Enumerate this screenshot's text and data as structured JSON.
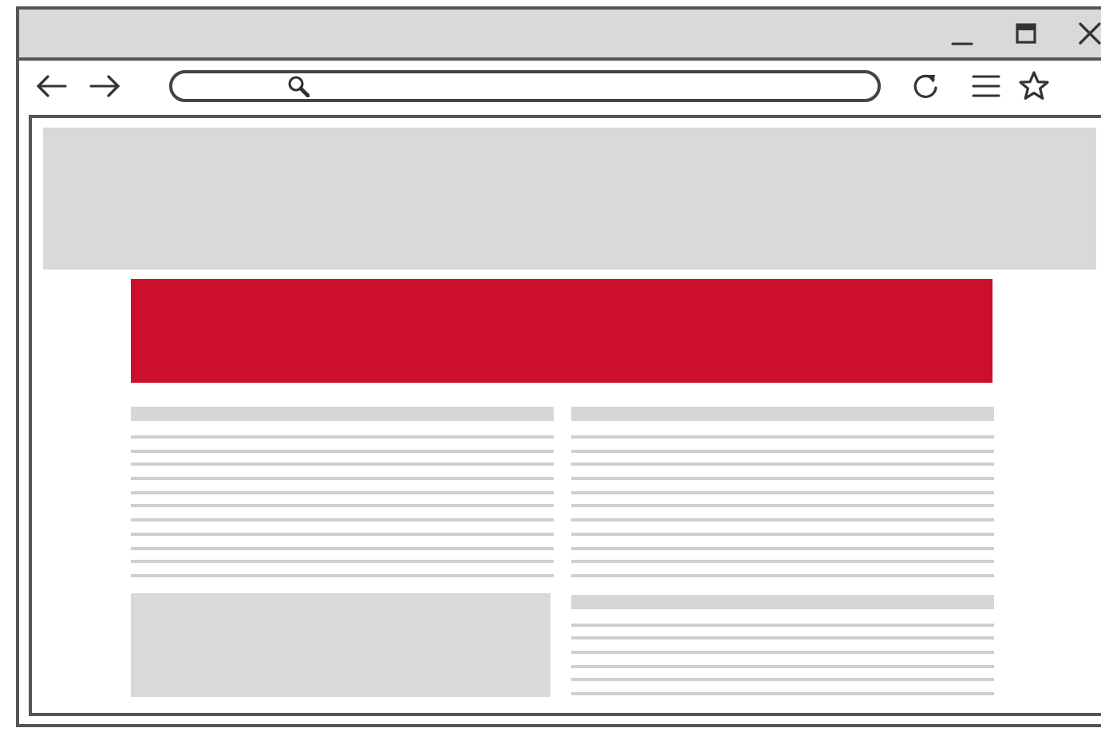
{
  "window": {
    "controls": [
      {
        "kind": "minimize"
      },
      {
        "kind": "maximize"
      },
      {
        "kind": "close"
      }
    ]
  },
  "toolbar": {
    "items": [
      {
        "kind": "back"
      },
      {
        "kind": "forward"
      },
      {
        "kind": "address"
      },
      {
        "kind": "reload"
      },
      {
        "kind": "menu"
      },
      {
        "kind": "bookmark"
      }
    ]
  },
  "page": {
    "header": {
      "kind": "placeholder"
    },
    "banner": {
      "color": "#cc0f2b"
    },
    "columns": [
      {
        "blocks": [
          {
            "kind": "heading"
          },
          {
            "kind": "line"
          },
          {
            "kind": "line"
          },
          {
            "kind": "line"
          },
          {
            "kind": "line"
          },
          {
            "kind": "line"
          },
          {
            "kind": "line"
          },
          {
            "kind": "line"
          },
          {
            "kind": "line"
          },
          {
            "kind": "line"
          },
          {
            "kind": "line"
          },
          {
            "kind": "line"
          },
          {
            "kind": "image"
          }
        ]
      },
      {
        "blocks": [
          {
            "kind": "heading"
          },
          {
            "kind": "line"
          },
          {
            "kind": "line"
          },
          {
            "kind": "line"
          },
          {
            "kind": "line"
          },
          {
            "kind": "line"
          },
          {
            "kind": "line"
          },
          {
            "kind": "line"
          },
          {
            "kind": "line"
          },
          {
            "kind": "line"
          },
          {
            "kind": "line"
          },
          {
            "kind": "line"
          },
          {
            "kind": "gap"
          },
          {
            "kind": "heading"
          },
          {
            "kind": "line"
          },
          {
            "kind": "line"
          },
          {
            "kind": "line"
          },
          {
            "kind": "line"
          },
          {
            "kind": "line"
          },
          {
            "kind": "line"
          }
        ]
      }
    ]
  }
}
